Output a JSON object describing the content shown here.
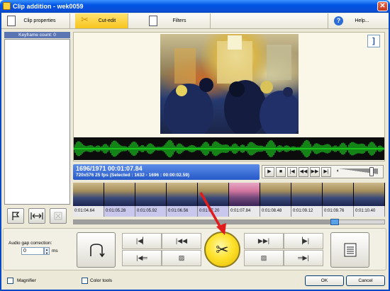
{
  "window": {
    "title": "Clip addition - wek0059",
    "close_glyph": "✕"
  },
  "toolbar": {
    "tabs": [
      {
        "label": "Clip properties",
        "icon": "document-icon"
      },
      {
        "label": "Cut-edit",
        "icon": "scissors-icon",
        "active": true
      },
      {
        "label": "Filters",
        "icon": "filter-edit-icon"
      },
      {
        "label": "Help...",
        "icon": "help-icon"
      }
    ]
  },
  "keyframes": {
    "header": "Keyframe count: 0",
    "buttons": [
      "flag",
      "span",
      "delete"
    ]
  },
  "preview": {
    "fit_label": "]"
  },
  "info": {
    "frame_time": "1696/1971  00:01:07.84",
    "details": "720x576 25  fps  (Selected : 1632 - 1696 : 00:00:02.59)"
  },
  "transport": {
    "buttons": [
      "play",
      "stop",
      "prev-frame",
      "rewind",
      "fast-forward",
      "next-frame",
      "volume"
    ]
  },
  "timeline": {
    "timecodes": [
      "0:01:04.64",
      "0:01:05.28",
      "0:01:05.92",
      "0:01:06.56",
      "0:01:07.20",
      "0:01:07.84",
      "0:01:08.48",
      "0:01:09.12",
      "0:01:09.76",
      "0:01:10.40"
    ]
  },
  "audio_gap": {
    "label": "Audio gap correction:",
    "value": "0",
    "unit": "ms"
  },
  "bottom": {
    "magnifier": "Magnifier",
    "color_tools": "Color tools",
    "ok": "OK",
    "cancel": "Cancel"
  },
  "colors": {
    "accent": "#f7c51d",
    "title_bar": "#0054e3",
    "waveform": "#19d41e",
    "selection": "#d2769f"
  }
}
